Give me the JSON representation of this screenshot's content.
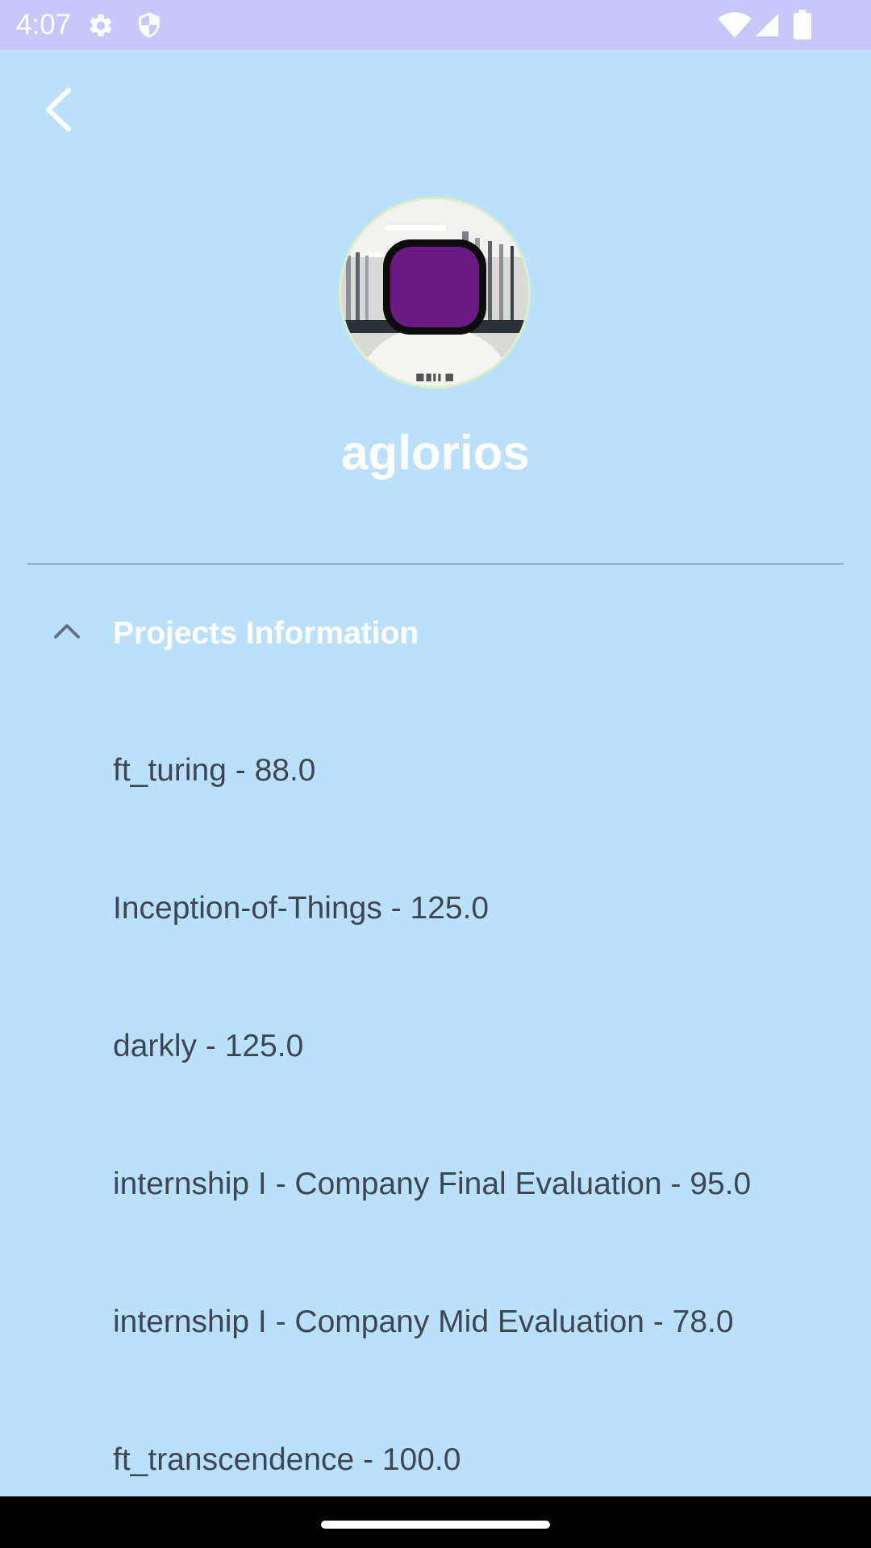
{
  "status_bar": {
    "time": "4:07",
    "icons": [
      "gear-icon",
      "shield-icon",
      "wifi-icon",
      "signal-icon",
      "battery-icon"
    ]
  },
  "header": {
    "back_icon": "chevron-left-icon"
  },
  "profile": {
    "username": "aglorios"
  },
  "projects_section": {
    "title": "Projects Information",
    "expanded": true,
    "items": [
      {
        "label": "ft_turing - 88.0"
      },
      {
        "label": "Inception-of-Things - 125.0"
      },
      {
        "label": "darkly - 125.0"
      },
      {
        "label": "internship I - Company Final Evaluation - 95.0"
      },
      {
        "label": "internship I - Company Mid Evaluation - 78.0"
      },
      {
        "label": "ft_transcendence - 100.0"
      }
    ]
  },
  "colors": {
    "background": "#bbe0fc",
    "status_bar": "#c9c6fc",
    "item_text": "#3d4750",
    "header_text": "#ffffff",
    "divider": "#93b5cf"
  }
}
